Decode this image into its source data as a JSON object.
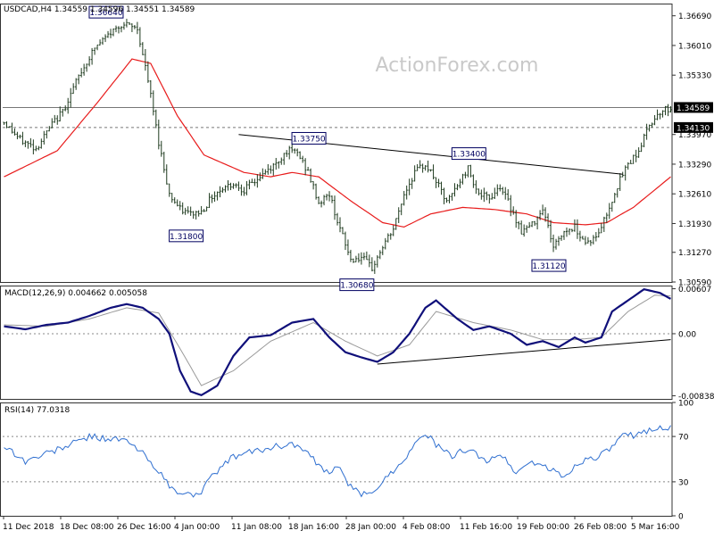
{
  "header": {
    "symbol_info": "USDCAD,H4  1.34559 1.34596 1.34551 1.34589",
    "corner_label": "",
    "watermark": "ActionForex.com"
  },
  "colors": {
    "background": "#ffffff",
    "candles": "#1e3a1e",
    "moving_average": "#e81c1c",
    "macd_line": "#10107a",
    "signal_line": "#9a9a9a",
    "rsi_line": "#2f6fd0",
    "grid": "#555555",
    "label_border": "#000060",
    "trendline": "#000000"
  },
  "chart_data": [
    {
      "panel": "price",
      "type": "candlestick",
      "title": "USDCAD,H4",
      "ylim": [
        1.3059,
        1.3697
      ],
      "y_ticks": [
        1.3669,
        1.3601,
        1.3533,
        1.34589,
        1.3397,
        1.3329,
        1.3261,
        1.3193,
        1.3127,
        1.3059
      ],
      "y_tick_labels": [
        "1.36690",
        "1.36010",
        "1.35330",
        "1.34589",
        "1.33970",
        "1.33290",
        "1.32610",
        "1.31930",
        "1.31270",
        "1.30590"
      ],
      "x_ticks": [
        "11 Dec 2018",
        "18 Dec 08:00",
        "26 Dec 16:00",
        "4 Jan 00:00",
        "11 Jan 08:00",
        "18 Jan 16:00",
        "28 Jan 00:00",
        "4 Feb 08:00",
        "11 Feb 16:00",
        "19 Feb 00:00",
        "26 Feb 08:00",
        "5 Mar 16:00"
      ],
      "close_anchors": [
        [
          0,
          1.3425
        ],
        [
          6,
          1.3385
        ],
        [
          12,
          1.3365
        ],
        [
          18,
          1.342
        ],
        [
          22,
          1.345
        ],
        [
          28,
          1.353
        ],
        [
          34,
          1.3595
        ],
        [
          40,
          1.363
        ],
        [
          44,
          1.365
        ],
        [
          50,
          1.364
        ],
        [
          54,
          1.352
        ],
        [
          58,
          1.338
        ],
        [
          62,
          1.326
        ],
        [
          66,
          1.3225
        ],
        [
          70,
          1.3215
        ],
        [
          74,
          1.322
        ],
        [
          78,
          1.3255
        ],
        [
          82,
          1.3275
        ],
        [
          86,
          1.3285
        ],
        [
          90,
          1.327
        ],
        [
          94,
          1.329
        ],
        [
          98,
          1.331
        ],
        [
          102,
          1.333
        ],
        [
          106,
          1.336
        ],
        [
          110,
          1.3355
        ],
        [
          114,
          1.331
        ],
        [
          118,
          1.324
        ],
        [
          122,
          1.326
        ],
        [
          126,
          1.318
        ],
        [
          130,
          1.311
        ],
        [
          134,
          1.3115
        ],
        [
          138,
          1.309
        ],
        [
          142,
          1.314
        ],
        [
          146,
          1.318
        ],
        [
          150,
          1.326
        ],
        [
          154,
          1.331
        ],
        [
          158,
          1.333
        ],
        [
          162,
          1.329
        ],
        [
          166,
          1.324
        ],
        [
          170,
          1.328
        ],
        [
          174,
          1.332
        ],
        [
          178,
          1.326
        ],
        [
          182,
          1.325
        ],
        [
          186,
          1.328
        ],
        [
          190,
          1.323
        ],
        [
          194,
          1.3175
        ],
        [
          198,
          1.319
        ],
        [
          202,
          1.323
        ],
        [
          206,
          1.314
        ],
        [
          210,
          1.3175
        ],
        [
          214,
          1.3185
        ],
        [
          218,
          1.315
        ],
        [
          222,
          1.316
        ],
        [
          226,
          1.3215
        ],
        [
          230,
          1.328
        ],
        [
          234,
          1.333
        ],
        [
          238,
          1.336
        ],
        [
          242,
          1.342
        ],
        [
          246,
          1.345
        ],
        [
          250,
          1.3459
        ]
      ],
      "moving_average_anchors": [
        [
          0,
          1.33
        ],
        [
          20,
          1.336
        ],
        [
          35,
          1.347
        ],
        [
          48,
          1.357
        ],
        [
          55,
          1.356
        ],
        [
          65,
          1.344
        ],
        [
          75,
          1.335
        ],
        [
          90,
          1.331
        ],
        [
          100,
          1.33
        ],
        [
          108,
          1.331
        ],
        [
          118,
          1.33
        ],
        [
          130,
          1.3245
        ],
        [
          142,
          1.3195
        ],
        [
          150,
          1.3185
        ],
        [
          160,
          1.3215
        ],
        [
          172,
          1.323
        ],
        [
          184,
          1.3225
        ],
        [
          196,
          1.3215
        ],
        [
          206,
          1.3195
        ],
        [
          218,
          1.319
        ],
        [
          226,
          1.3195
        ],
        [
          236,
          1.323
        ],
        [
          244,
          1.327
        ],
        [
          250,
          1.33
        ]
      ],
      "labels": [
        {
          "text": "1.36640",
          "bar": 44,
          "price": 1.3664,
          "place": "left-above"
        },
        {
          "text": "1.31800",
          "bar": 74,
          "price": 1.318,
          "place": "left-below"
        },
        {
          "text": "1.33750",
          "bar": 120,
          "price": 1.3375,
          "place": "left-above"
        },
        {
          "text": "1.30680",
          "bar": 138,
          "price": 1.3068,
          "place": "left-below"
        },
        {
          "text": "1.33400",
          "bar": 180,
          "price": 1.334,
          "place": "left-above"
        },
        {
          "text": "1.31120",
          "bar": 210,
          "price": 1.3112,
          "place": "left-below"
        }
      ],
      "levels": [
        {
          "label": "1.34589",
          "price": 1.34589,
          "style": "solid"
        },
        {
          "label": "1.34130",
          "price": 1.3413,
          "style": "dashed"
        }
      ],
      "trendline": {
        "from": [
          88,
          1.3397
        ],
        "to": [
          232,
          1.3306
        ]
      },
      "bar_count": 251
    },
    {
      "panel": "macd",
      "type": "line",
      "title": "MACD(12,26,9) 0.004662 0.005058",
      "ylim": [
        -0.0088,
        0.0065
      ],
      "y_tick_labels": [
        "0.00607",
        "0.00",
        "-0.008381"
      ],
      "macd_anchors": [
        [
          0,
          0.001
        ],
        [
          8,
          0.0006
        ],
        [
          16,
          0.0012
        ],
        [
          24,
          0.0015
        ],
        [
          32,
          0.0024
        ],
        [
          40,
          0.0035
        ],
        [
          46,
          0.004
        ],
        [
          52,
          0.0035
        ],
        [
          58,
          0.002
        ],
        [
          62,
          0.0
        ],
        [
          66,
          -0.005
        ],
        [
          70,
          -0.0078
        ],
        [
          74,
          -0.0083
        ],
        [
          80,
          -0.007
        ],
        [
          86,
          -0.003
        ],
        [
          92,
          -0.0005
        ],
        [
          100,
          -0.0002
        ],
        [
          108,
          0.0015
        ],
        [
          116,
          0.002
        ],
        [
          122,
          -0.0005
        ],
        [
          128,
          -0.0025
        ],
        [
          134,
          -0.0032
        ],
        [
          140,
          -0.0038
        ],
        [
          146,
          -0.0025
        ],
        [
          152,
          0.0
        ],
        [
          158,
          0.0035
        ],
        [
          162,
          0.0045
        ],
        [
          170,
          0.002
        ],
        [
          176,
          0.0005
        ],
        [
          182,
          0.001
        ],
        [
          190,
          0.0
        ],
        [
          196,
          -0.0015
        ],
        [
          202,
          -0.001
        ],
        [
          208,
          -0.0018
        ],
        [
          214,
          -0.0005
        ],
        [
          218,
          -0.0012
        ],
        [
          224,
          -0.0005
        ],
        [
          228,
          0.003
        ],
        [
          234,
          0.0045
        ],
        [
          240,
          0.006
        ],
        [
          246,
          0.0055
        ],
        [
          250,
          0.0047
        ]
      ],
      "signal_anchors": [
        [
          0,
          0.0012
        ],
        [
          16,
          0.001
        ],
        [
          32,
          0.002
        ],
        [
          46,
          0.0035
        ],
        [
          58,
          0.0028
        ],
        [
          66,
          -0.002
        ],
        [
          74,
          -0.007
        ],
        [
          86,
          -0.005
        ],
        [
          100,
          -0.001
        ],
        [
          116,
          0.0015
        ],
        [
          128,
          -0.001
        ],
        [
          140,
          -0.003
        ],
        [
          152,
          -0.0015
        ],
        [
          162,
          0.003
        ],
        [
          176,
          0.0015
        ],
        [
          190,
          0.0005
        ],
        [
          202,
          -0.0008
        ],
        [
          214,
          -0.0008
        ],
        [
          224,
          -0.0005
        ],
        [
          234,
          0.003
        ],
        [
          244,
          0.0052
        ],
        [
          250,
          0.0051
        ]
      ],
      "trendline": {
        "from": [
          140,
          -0.0041
        ],
        "to": [
          250,
          -0.0008
        ]
      }
    },
    {
      "panel": "rsi",
      "type": "line",
      "title": "RSI(14) 77.0318",
      "ylim": [
        0,
        100
      ],
      "y_ticks": [
        100,
        70,
        30,
        0
      ],
      "y_tick_labels": [
        "100",
        "70",
        "30",
        "0"
      ],
      "levels": [
        70,
        30
      ],
      "rsi_anchors": [
        [
          0,
          62
        ],
        [
          8,
          48
        ],
        [
          16,
          55
        ],
        [
          24,
          62
        ],
        [
          32,
          70
        ],
        [
          40,
          68
        ],
        [
          46,
          66
        ],
        [
          52,
          55
        ],
        [
          58,
          40
        ],
        [
          62,
          25
        ],
        [
          66,
          20
        ],
        [
          70,
          18
        ],
        [
          74,
          22
        ],
        [
          80,
          40
        ],
        [
          86,
          52
        ],
        [
          92,
          56
        ],
        [
          100,
          60
        ],
        [
          108,
          64
        ],
        [
          114,
          55
        ],
        [
          120,
          38
        ],
        [
          126,
          42
        ],
        [
          130,
          25
        ],
        [
          134,
          18
        ],
        [
          138,
          22
        ],
        [
          142,
          30
        ],
        [
          148,
          45
        ],
        [
          154,
          62
        ],
        [
          158,
          74
        ],
        [
          162,
          62
        ],
        [
          168,
          52
        ],
        [
          174,
          60
        ],
        [
          180,
          48
        ],
        [
          186,
          55
        ],
        [
          192,
          38
        ],
        [
          198,
          48
        ],
        [
          204,
          42
        ],
        [
          210,
          34
        ],
        [
          216,
          48
        ],
        [
          222,
          52
        ],
        [
          226,
          56
        ],
        [
          232,
          70
        ],
        [
          238,
          72
        ],
        [
          244,
          78
        ],
        [
          250,
          77
        ]
      ]
    }
  ]
}
